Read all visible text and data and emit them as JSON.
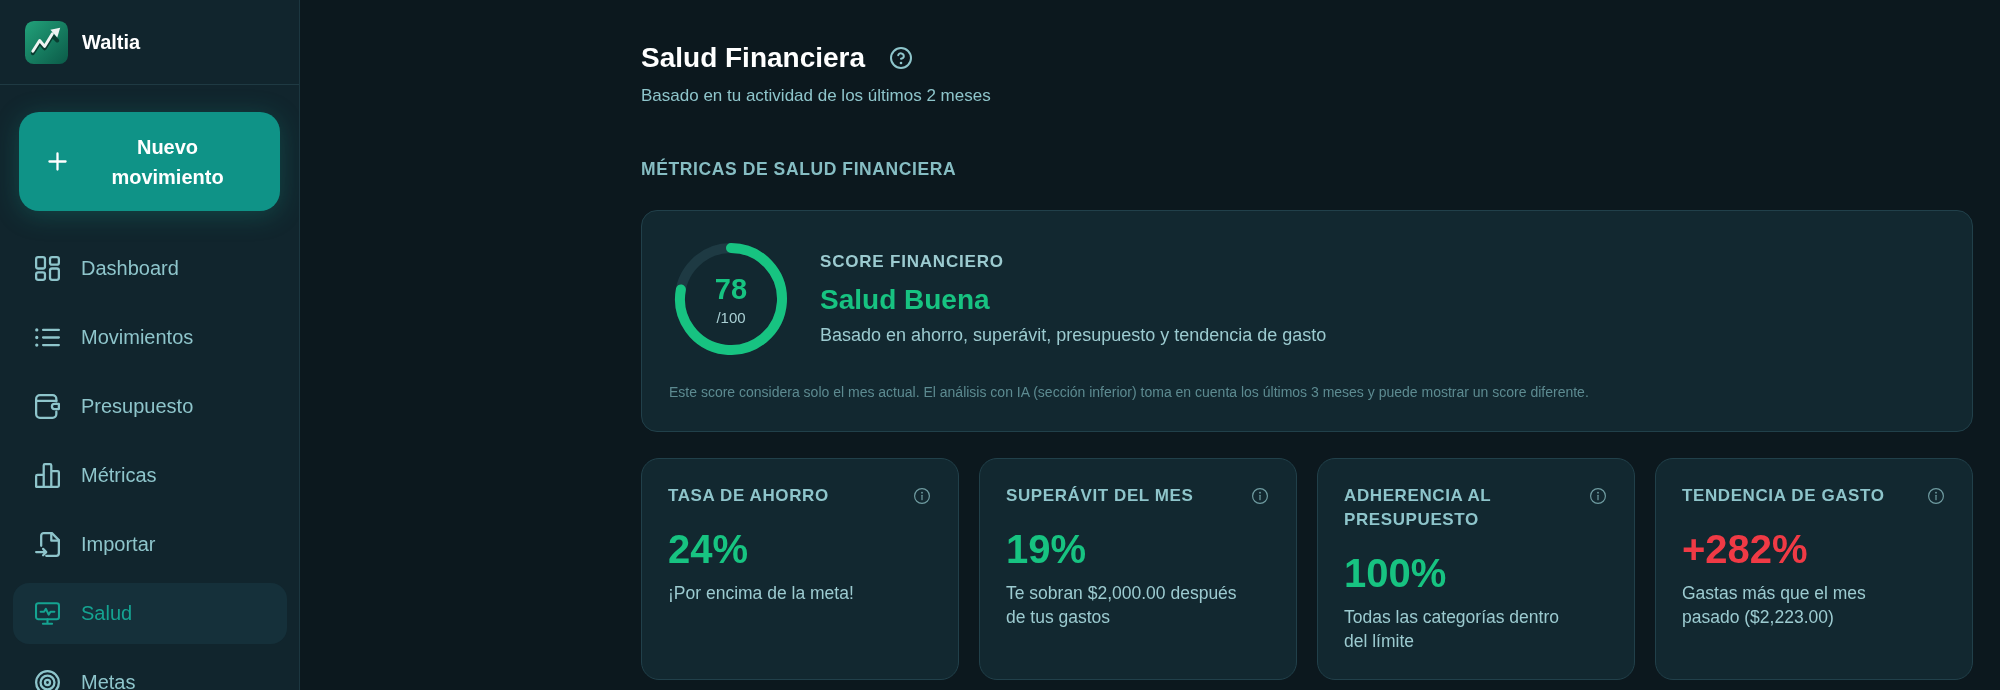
{
  "brand": {
    "name": "Waltia"
  },
  "new_button": {
    "label": "Nuevo movimiento"
  },
  "nav": [
    {
      "label": "Dashboard",
      "selected": false
    },
    {
      "label": "Movimientos",
      "selected": false
    },
    {
      "label": "Presupuesto",
      "selected": false
    },
    {
      "label": "Métricas",
      "selected": false
    },
    {
      "label": "Importar",
      "selected": false
    },
    {
      "label": "Salud",
      "selected": true
    },
    {
      "label": "Metas",
      "selected": false
    }
  ],
  "page": {
    "title": "Salud Financiera",
    "subtitle": "Basado en tu actividad de los últimos 2 meses"
  },
  "section": {
    "heading": "MÉTRICAS DE SALUD FINANCIERA"
  },
  "score_card": {
    "label": "SCORE FINANCIERO",
    "score": "78",
    "max": "/100",
    "status": "Salud Buena",
    "description": "Basado en ahorro, superávit, presupuesto y tendencia de gasto",
    "note": "Este score considera solo el mes actual. El análisis con IA (sección inferior) toma en cuenta los últimos 3 meses y puede mostrar un score diferente."
  },
  "metrics": [
    {
      "label": "TASA DE AHORRO",
      "value": "24%",
      "color": "#17c381",
      "description": "¡Por encima de la meta!"
    },
    {
      "label": "SUPERÁVIT DEL MES",
      "value": "19%",
      "color": "#17c381",
      "description": "Te sobran $2,000.00 después de tus gastos"
    },
    {
      "label": "ADHERENCIA AL PRESUPUESTO",
      "value": "100%",
      "color": "#17c381",
      "description": "Todas las categorías dentro del límite"
    },
    {
      "label": "TENDENCIA DE GASTO",
      "value": "+282%",
      "color": "#f03a45",
      "description": "Gastas más que el mes pasado ($2,223.00)"
    }
  ]
}
